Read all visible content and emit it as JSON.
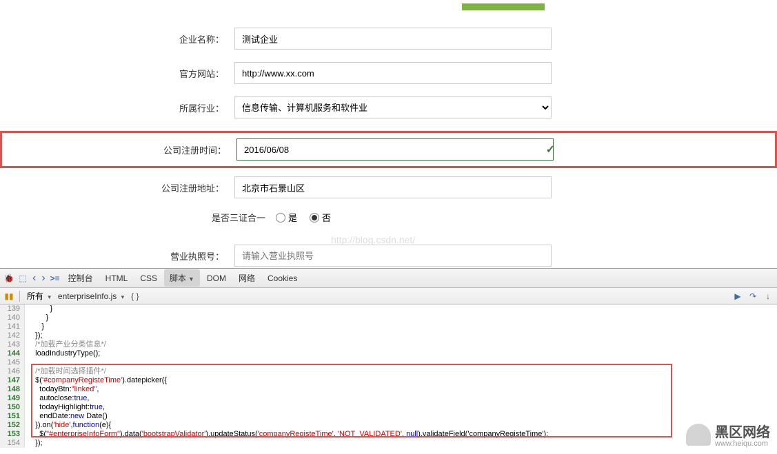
{
  "form": {
    "company_name_label": "企业名称：",
    "company_name_value": "测试企业",
    "website_label": "官方网站：",
    "website_value": "http://www.xx.com",
    "industry_label": "所属行业：",
    "industry_value": "信息传输、计算机服务和软件业",
    "reg_time_label": "公司注册时间：",
    "reg_time_value": "2016/06/08",
    "reg_addr_label": "公司注册地址：",
    "reg_addr_value": "北京市石景山区",
    "merge_cert_label": "是否三证合一",
    "radio_yes": "是",
    "radio_no": "否",
    "license_label": "营业执照号：",
    "license_placeholder": "请输入营业执照号",
    "watermark_url": "http://blog.csdn.net/"
  },
  "devtools": {
    "tabs": {
      "console": "控制台",
      "html": "HTML",
      "css": "CSS",
      "script": "脚本",
      "dom": "DOM",
      "net": "网络",
      "cookies": "Cookies"
    },
    "subbar": {
      "all": "所有",
      "file": "enterpriseInfo.js"
    },
    "code": [
      {
        "n": "139",
        "b": false,
        "t": "          }"
      },
      {
        "n": "140",
        "b": false,
        "t": "        }"
      },
      {
        "n": "141",
        "b": false,
        "t": "      }"
      },
      {
        "n": "142",
        "b": false,
        "t": "   });"
      },
      {
        "n": "143",
        "b": false,
        "t": "   /*加载产业分类信息*/",
        "cmt": true
      },
      {
        "n": "144",
        "b": true,
        "t": "   loadIndustryType();"
      },
      {
        "n": "145",
        "b": false,
        "t": ""
      },
      {
        "n": "146",
        "b": false,
        "t": "   /*加载时间选择插件*/",
        "cmt": true
      },
      {
        "n": "147",
        "b": true,
        "t": "   $('#companyRegisteTime').datepicker({",
        "strs": [
          "#companyRegisteTime"
        ]
      },
      {
        "n": "148",
        "b": true,
        "t": "     todayBtn:\"linked\",",
        "strs": [
          "linked"
        ]
      },
      {
        "n": "149",
        "b": true,
        "t": "     autoclose:true,",
        "kws": [
          "true"
        ]
      },
      {
        "n": "150",
        "b": true,
        "t": "     todayHighlight:true,",
        "kws": [
          "true"
        ]
      },
      {
        "n": "151",
        "b": true,
        "t": "     endDate:new Date()",
        "kws": [
          "new"
        ]
      },
      {
        "n": "152",
        "b": true,
        "t": "   }).on('hide',function(e){",
        "strs": [
          "hide"
        ],
        "kws": [
          "function"
        ]
      },
      {
        "n": "153",
        "b": true,
        "t": "     $(\"#enterpriseInfoForm\").data('bootstrapValidator').updateStatus('companyRegisteTime', 'NOT_VALIDATED', null).validateField('companyRegisteTime');",
        "strs": [
          "#enterpriseInfoForm",
          "bootstrapValidator",
          "companyRegisteTime",
          "NOT_VALIDATED",
          "companyRegisteTime"
        ],
        "kws": [
          "null"
        ]
      },
      {
        "n": "154",
        "b": false,
        "t": "   });"
      }
    ]
  },
  "watermark": {
    "title": "黑区网络",
    "sub": "www.heiqu.com"
  }
}
